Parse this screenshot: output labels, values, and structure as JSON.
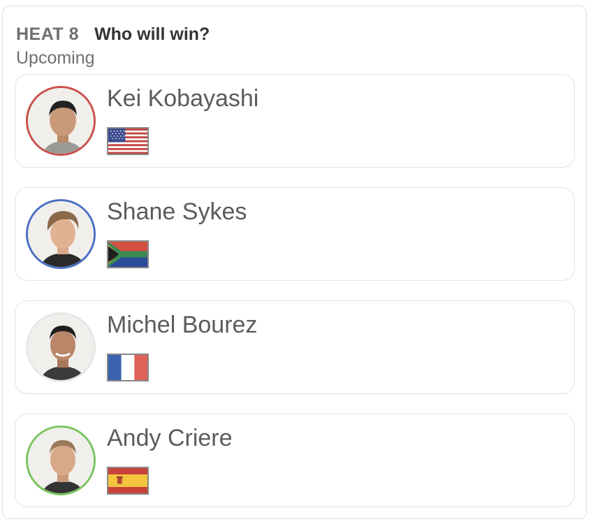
{
  "header": {
    "heat": "HEAT 8",
    "question": "Who will win?",
    "status": "Upcoming"
  },
  "surfers": [
    {
      "name": "Kei Kobayashi",
      "flag": "flag-usa-icon",
      "ring_color": "#c9504b"
    },
    {
      "name": "Shane Sykes",
      "flag": "flag-south-africa-icon",
      "ring_color": "#4a6fc4"
    },
    {
      "name": "Michel Bourez",
      "flag": "flag-france-icon",
      "ring_color": "#e8e8e8"
    },
    {
      "name": "Andy Criere",
      "flag": "flag-spain-icon",
      "ring_color": "#79c55e"
    }
  ]
}
